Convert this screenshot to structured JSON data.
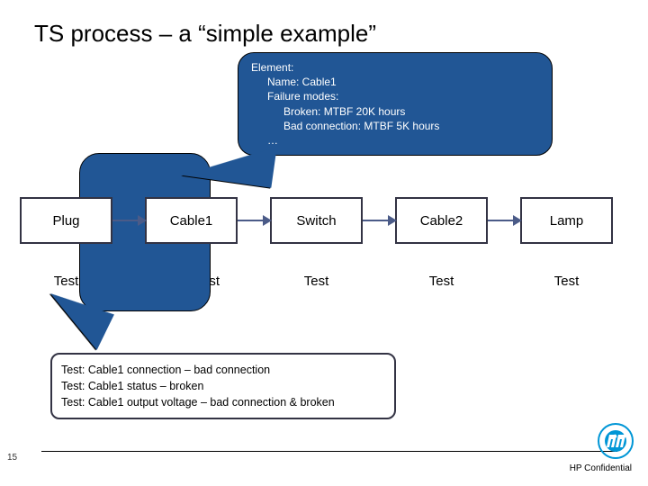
{
  "title": "TS process – a “simple example”",
  "callout_top": {
    "element": "Element:",
    "name_label": "Name: Cable1",
    "failure_modes_label": "Failure modes:",
    "fm1": "Broken: MTBF 20K hours",
    "fm2": "Bad connection: MTBF 5K hours",
    "ellipsis": "…"
  },
  "flow": [
    "Plug",
    "Cable1",
    "Switch",
    "Cable2",
    "Lamp"
  ],
  "tests": [
    "Test",
    "st",
    "Test",
    "Test",
    "Test"
  ],
  "callout_bot": {
    "l1": "Test: Cable1 connection – bad connection",
    "l2": "Test: Cable1 status – broken",
    "l3": "Test: Cable1 output voltage – bad connection & broken"
  },
  "page_number": "15",
  "confidential": "HP Confidential"
}
